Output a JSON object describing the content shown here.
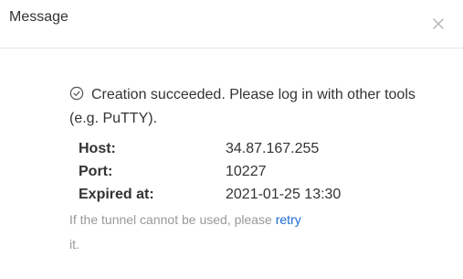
{
  "dialog": {
    "title": "Message",
    "close_icon": "close-icon"
  },
  "body": {
    "success_icon": "check-circle-icon",
    "success_text": "Creation succeeded. Please log in with other tools (e.g. PuTTY).",
    "fields": [
      {
        "label": "Host:",
        "value": "34.87.167.255"
      },
      {
        "label": "Port:",
        "value": "10227"
      },
      {
        "label": "Expired at:",
        "value": "2021-01-25 13:30"
      }
    ],
    "note_prefix": "If the tunnel cannot be used, please",
    "retry_label": "retry",
    "note_suffix": "it."
  },
  "colors": {
    "text": "#333333",
    "muted": "#999999",
    "link": "#1a6bd6",
    "divider": "#e6e6e6"
  }
}
